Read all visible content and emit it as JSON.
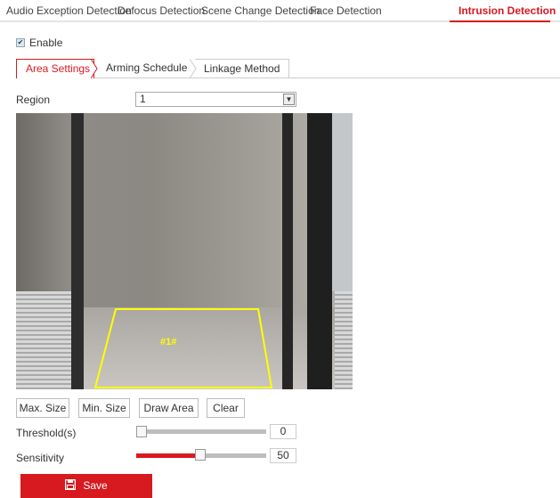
{
  "tabs": [
    {
      "label": "Audio Exception Detection"
    },
    {
      "label": "Defocus Detection"
    },
    {
      "label": "Scene Change Detection"
    },
    {
      "label": "Face Detection"
    },
    {
      "label": "Intrusion Detection",
      "active": true
    }
  ],
  "enable": {
    "label": "Enable",
    "checked": true
  },
  "subtabs": [
    {
      "label": "Area Settings",
      "active": true
    },
    {
      "label": "Arming Schedule"
    },
    {
      "label": "Linkage Method"
    }
  ],
  "region": {
    "label": "Region",
    "value": "1"
  },
  "video": {
    "region_label": "#1#",
    "region_color": "#ffff00"
  },
  "buttons": {
    "max_size": "Max. Size",
    "min_size": "Min. Size",
    "draw_area": "Draw Area",
    "clear": "Clear"
  },
  "threshold": {
    "label": "Threshold(s)",
    "value": "0",
    "fraction": 0
  },
  "sensitivity": {
    "label": "Sensitivity",
    "value": "50",
    "fraction": 0.5
  },
  "save": {
    "label": "Save",
    "icon": "save-icon"
  },
  "colors": {
    "accent": "#d71920"
  }
}
